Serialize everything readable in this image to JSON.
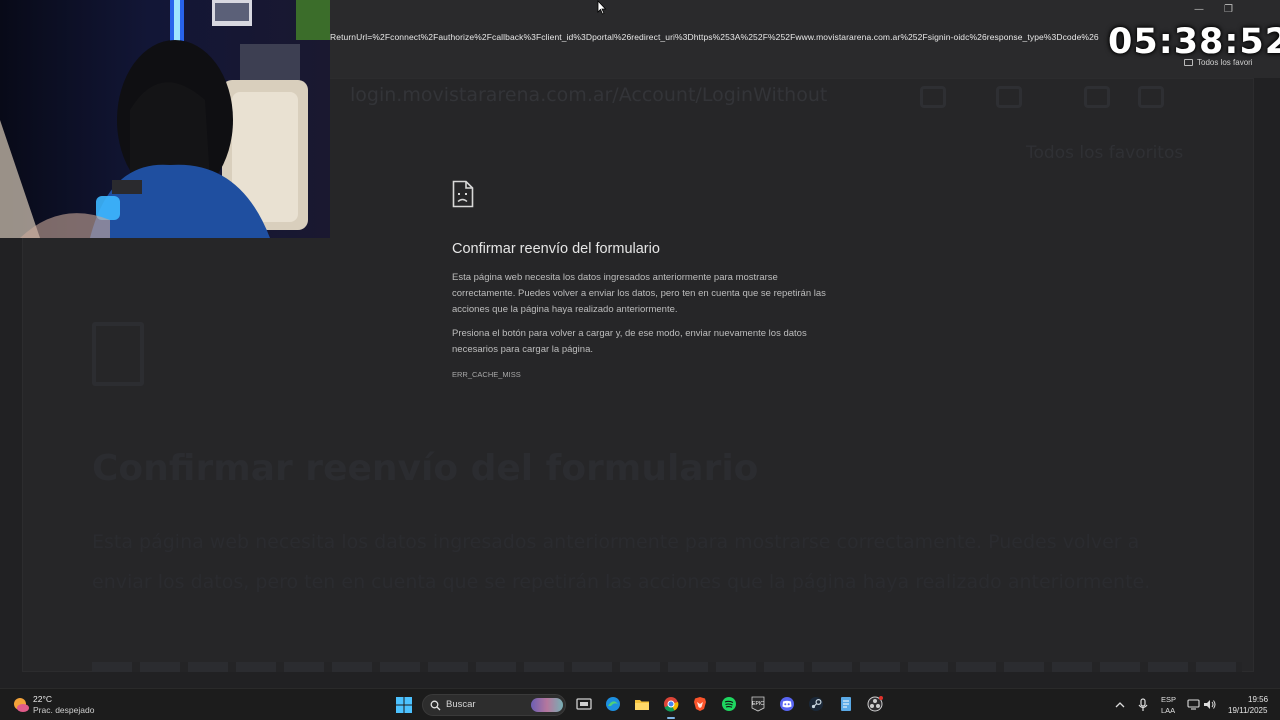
{
  "browser": {
    "url_fragment": "ReturnUrl=%2Fconnect%2Fauthorize%2Fcallback%3Fclient_id%3Dportal%26redirect_uri%3Dhttps%253A%252F%252Fwww.movistararena.com.ar%252Fsignin-oidc%26response_type%3Dcode%26",
    "favorites_label": "Todos los favori",
    "background_address": "login.movistararena.com.ar/Account/LoginWithout"
  },
  "stream": {
    "timer": "05:38:52"
  },
  "error_page": {
    "title": "Confirmar reenvío del formulario",
    "paragraph1": "Esta página web necesita los datos ingresados anteriormente para mostrarse correctamente. Puedes volver a enviar los datos, pero ten en cuenta que se repetirán las acciones que la página haya realizado anteriormente.",
    "paragraph2": "Presiona el botón para volver a cargar y, de ese modo, enviar nuevamente los datos necesarios para cargar la página.",
    "error_code": "ERR_CACHE_MISS"
  },
  "background_blur": {
    "favorites_label": "Todos los favoritos",
    "title": "Confirmar reenvío del formulario",
    "paragraph": "Esta página web necesita los datos ingresados anteriormente para mostrarse correctamente. Puedes volver a enviar los datos, pero ten en cuenta que se repetirán las acciones que la página haya realizado anteriormente."
  },
  "taskbar": {
    "weather_temp": "22°C",
    "weather_desc": "Prac. despejado",
    "search_placeholder": "Buscar",
    "apps": [
      "task-view",
      "edge",
      "file-explorer",
      "chrome",
      "brave",
      "spotify",
      "epic-games",
      "discord",
      "steam",
      "notepad",
      "obs"
    ],
    "language_top": "ESP",
    "language_bottom": "LAA",
    "time": "19:56",
    "date": "19/11/2025"
  },
  "colors": {
    "page_bg": "#212123",
    "taskbar_bg": "#1c1c1c",
    "text_primary": "#e6e6e6",
    "text_secondary": "#bdbdbd",
    "accent": "#7fb5e6"
  }
}
